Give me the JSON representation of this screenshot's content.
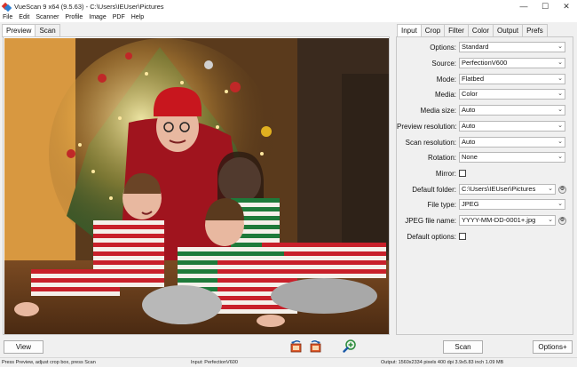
{
  "window": {
    "title": "VueScan 9 x64 (9.5.63) - C:\\Users\\IEUser\\Pictures",
    "controls": {
      "minimize": "—",
      "maximize": "☐",
      "close": "✕"
    }
  },
  "menu": [
    "File",
    "Edit",
    "Scanner",
    "Profile",
    "Image",
    "PDF",
    "Help"
  ],
  "left_tabs": [
    "Preview",
    "Scan"
  ],
  "right_tabs": [
    "Input",
    "Crop",
    "Filter",
    "Color",
    "Output",
    "Prefs"
  ],
  "settings": {
    "options": {
      "label": "Options:",
      "value": "Standard"
    },
    "source": {
      "label": "Source:",
      "value": "PerfectionV600"
    },
    "mode": {
      "label": "Mode:",
      "value": "Flatbed"
    },
    "media": {
      "label": "Media:",
      "value": "Color"
    },
    "media_size": {
      "label": "Media size:",
      "value": "Auto"
    },
    "preview_resolution": {
      "label": "Preview resolution:",
      "value": "Auto"
    },
    "scan_resolution": {
      "label": "Scan resolution:",
      "value": "Auto"
    },
    "rotation": {
      "label": "Rotation:",
      "value": "None"
    },
    "mirror": {
      "label": "Mirror:"
    },
    "default_folder": {
      "label": "Default folder:",
      "value": "C:\\Users\\IEUser\\Pictures"
    },
    "file_type": {
      "label": "File type:",
      "value": "JPEG"
    },
    "jpeg_file_name": {
      "label": "JPEG file name:",
      "value": "YYYY-MM-DD-0001+.jpg"
    },
    "default_options": {
      "label": "Default options:"
    }
  },
  "buttons": {
    "view": "View",
    "scan": "Scan",
    "options": "Options+"
  },
  "status": {
    "left": "Press Preview, adjust crop box, press Scan",
    "middle": "Input: PerfectionV600",
    "right": "Output: 1560x2334 pixels 400 dpi 3.9x5.83 inch 1.09 MB"
  }
}
